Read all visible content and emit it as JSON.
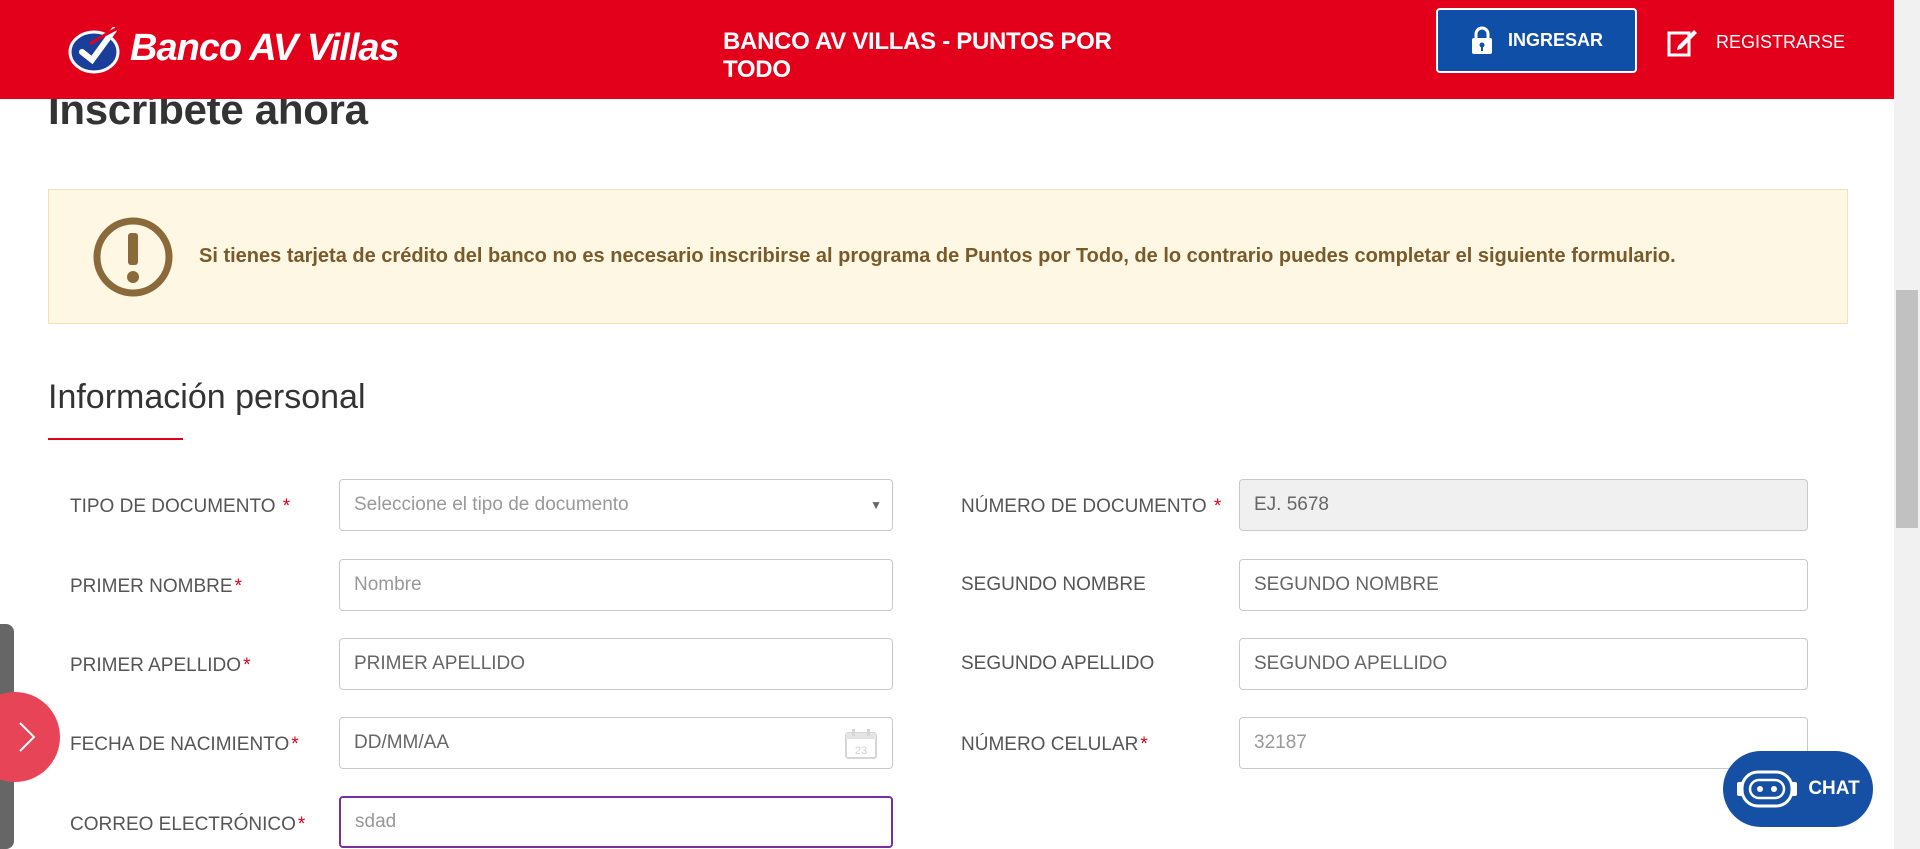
{
  "header": {
    "brand": "Banco AV Villas",
    "title": "BANCO AV VILLAS - PUNTOS POR TODO",
    "login_label": "INGRESAR",
    "register_label": "REGISTRARSE",
    "bg_color": "#e2001a",
    "login_color": "#0f4fa8"
  },
  "main": {
    "heading": "Inscríbete ahora",
    "alert_text": "Si tienes tarjeta de crédito del banco no es necesario inscribirse al programa de Puntos por Todo, de lo contrario puedes completar el siguiente formulario.",
    "section_title": "Información personal"
  },
  "form": {
    "doc_type_label": "TIPO DE DOCUMENTO",
    "doc_type_value": "Seleccione el tipo de documento",
    "doc_number_label": "NÚMERO DE DOCUMENTO",
    "doc_number_value": "EJ. 5678",
    "first_name_label": "PRIMER NOMBRE",
    "first_name_placeholder": "Nombre",
    "second_name_label": "SEGUNDO NOMBRE",
    "second_name_value": "SEGUNDO NOMBRE",
    "first_surname_label": "PRIMER APELLIDO",
    "first_surname_value": "PRIMER APELLIDO",
    "second_surname_label": "SEGUNDO APELLIDO",
    "second_surname_value": "SEGUNDO APELLIDO",
    "birthdate_label": "FECHA DE NACIMIENTO",
    "birthdate_value": "DD/MM/AA",
    "calendar_day": "23",
    "cell_label": "NÚMERO CELULAR",
    "cell_value": "32187",
    "email_label": "CORREO ELECTRÓNICO",
    "email_value": "sdad",
    "required_mark": "*"
  },
  "chat": {
    "label": "CHAT"
  }
}
